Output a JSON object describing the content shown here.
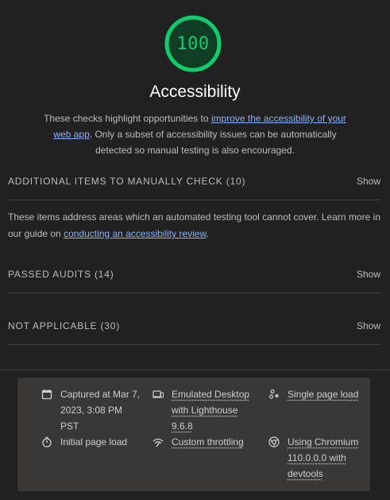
{
  "score": {
    "value": "100",
    "color": "#0cce6b",
    "track_color": "#0f3d26"
  },
  "title": "Accessibility",
  "description": {
    "before": "These checks highlight opportunities to ",
    "link": "improve the accessibility of your web app",
    "after": ". Only a subset of accessibility issues can be automatically detected so manual testing is also encouraged."
  },
  "sections": {
    "manual": {
      "title": "ADDITIONAL ITEMS TO MANUALLY CHECK (10)",
      "show": "Show"
    },
    "manual_desc": {
      "before": "These items address areas which an automated testing tool cannot cover. Learn more in our guide on ",
      "link": "conducting an accessibility review",
      "after": "."
    },
    "passed": {
      "title": "PASSED AUDITS (14)",
      "show": "Show"
    },
    "not_applicable": {
      "title": "NOT APPLICABLE (30)",
      "show": "Show"
    }
  },
  "runtime": {
    "captured": "Captured at Mar 7, 2023, 3:08 PM PST",
    "emulated": "Emulated Desktop with Lighthouse 9.6.8",
    "single_page": "Single page load",
    "initial_load": "Initial page load",
    "throttling": "Custom throttling",
    "browser": "Using Chromium 110.0.0.0 with devtools"
  },
  "icons": {
    "calendar": "calendar-icon",
    "device": "desktop-device-icon",
    "single_page": "single-page-icon",
    "timer": "stopwatch-icon",
    "throttle": "network-throttle-icon",
    "chrome": "chromium-icon"
  }
}
